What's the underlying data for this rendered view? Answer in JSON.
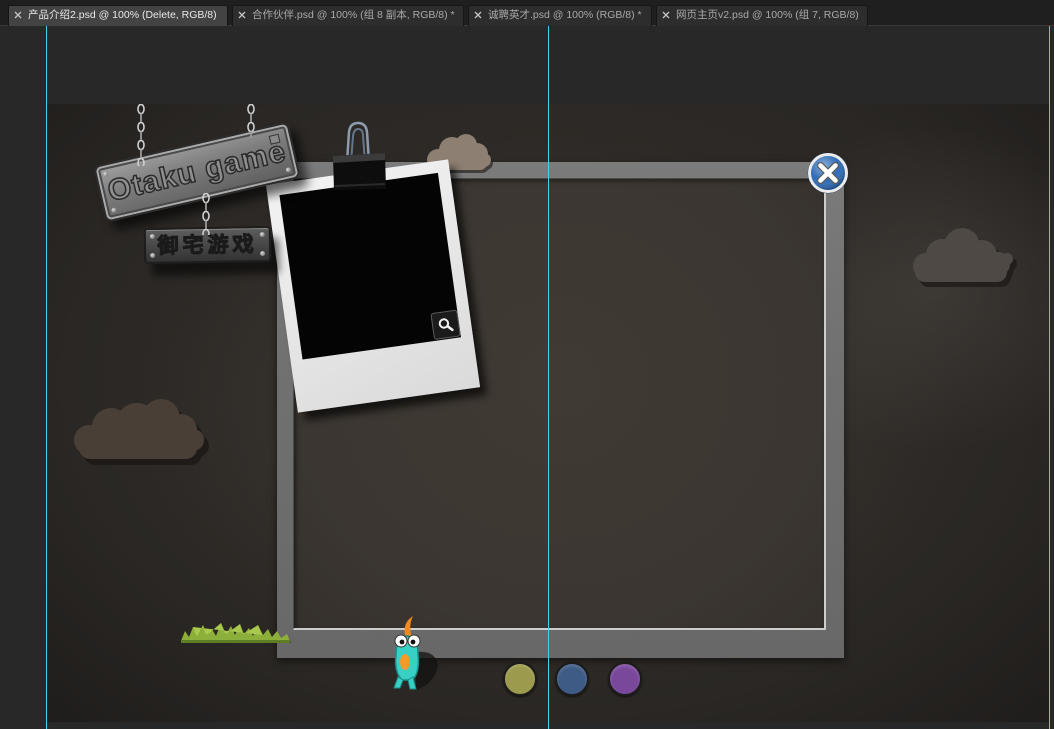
{
  "tabs": [
    {
      "label": "产品介绍2.psd @ 100% (Delete, RGB/8)",
      "active": true
    },
    {
      "label": "合作伙伴.psd @ 100% (组 8 副本, RGB/8) *",
      "active": false
    },
    {
      "label": "诚聘英才.psd @ 100% (RGB/8) *",
      "active": false
    },
    {
      "label": "网页主页v2.psd @ 100% (组 7, RGB/8)",
      "active": false
    }
  ],
  "icons": {
    "tab_close": "close-icon",
    "panel_close": "close-icon",
    "photo_zoom": "magnifier-icon",
    "photo_clip": "binder-clip-icon"
  },
  "canvas": {
    "sign": {
      "title": "Otaku game",
      "subtitle": "御宅游戏"
    },
    "close_button": {
      "color": "#2e6cb6"
    },
    "pagination_dots": [
      {
        "color": "#9c9a4c"
      },
      {
        "color": "#3d5b85"
      },
      {
        "color": "#7a489b"
      }
    ]
  },
  "colors": {
    "guide": "#3fd3e6",
    "tab_bg": "#2d2d2d",
    "tab_active_bg": "#434343",
    "pasteboard": "#282828",
    "frame": "#717171",
    "panel": "#3b3631"
  }
}
